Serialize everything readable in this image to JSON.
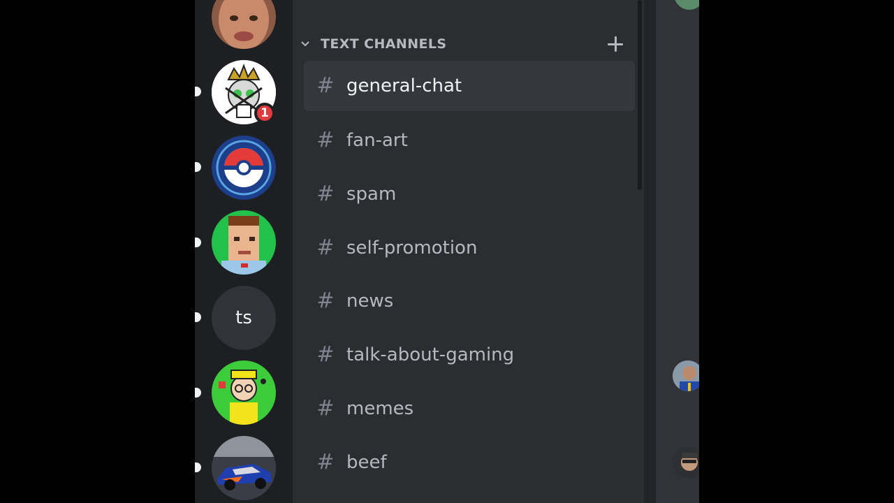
{
  "servers": [
    {
      "name": "server-tyler-avatar",
      "pill": false
    },
    {
      "name": "server-skull-king-avatar",
      "pill": true,
      "badge": "1"
    },
    {
      "name": "server-pokemon-go-avatar",
      "pill": true
    },
    {
      "name": "server-pixel-face-avatar",
      "pill": true
    },
    {
      "name": "server-ts",
      "pill": true,
      "initials": "ts"
    },
    {
      "name": "server-cartoon-avatar",
      "pill": true
    },
    {
      "name": "server-car-avatar",
      "pill": true
    }
  ],
  "category": {
    "label": "TEXT CHANNELS",
    "icons": {
      "collapse": "chevron-down-icon",
      "add": "plus-icon"
    }
  },
  "channels": [
    {
      "label": "general-chat",
      "active": true
    },
    {
      "label": "fan-art",
      "active": false
    },
    {
      "label": "spam",
      "active": false
    },
    {
      "label": "self-promotion",
      "active": false
    },
    {
      "label": "news",
      "active": false
    },
    {
      "label": "talk-about-gaming",
      "active": false
    },
    {
      "label": "memes",
      "active": false
    },
    {
      "label": "beef",
      "active": false
    }
  ],
  "colors": {
    "rail_bg": "#1e1f22",
    "panel_bg": "#2b2d31",
    "active_channel_bg": "#35373c",
    "badge_red": "#e03c3f",
    "text_muted": "#b5bac1",
    "text_active": "#f2f3f5"
  }
}
